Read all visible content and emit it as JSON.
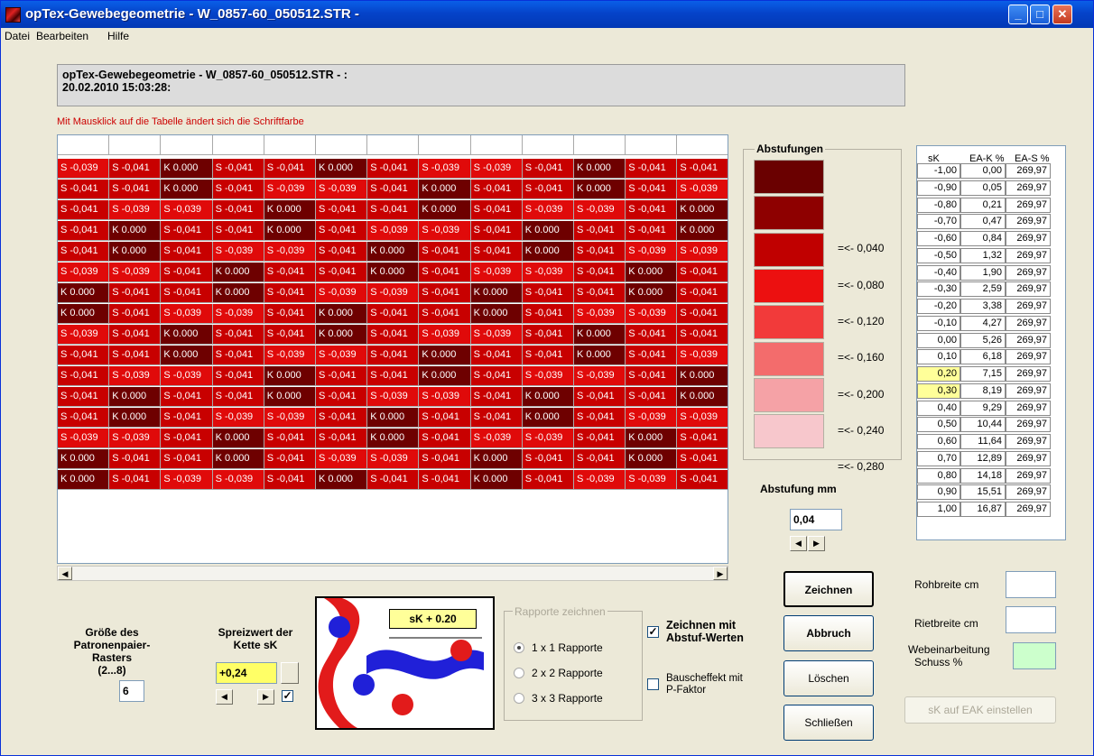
{
  "window": {
    "title": "opTex-Gewebegeometrie - W_0857-60_050512.STR -",
    "controls": [
      "_",
      "□",
      "✕"
    ]
  },
  "menu": [
    "Datei",
    "Bearbeiten",
    "Hilfe"
  ],
  "info": {
    "line1": "opTex-Gewebegeometrie - W_0857-60_050512.STR - :",
    "line2": "20.02.2010 15:03:28:"
  },
  "hint": "Mit Mausklick auf die Tabelle ändert sich die Schriftfarbe",
  "grid_rows": [
    [
      "S -0,039",
      "S -0,041",
      "K 0.000",
      "S -0,041",
      "S -0,041",
      "K 0.000",
      "S -0,041",
      "S -0,039",
      "S -0,039",
      "S -0,041",
      "K 0.000",
      "S -0,041",
      "S -0,041"
    ],
    [
      "S -0,041",
      "S -0,041",
      "K 0.000",
      "S -0,041",
      "S -0,039",
      "S -0,039",
      "S -0,041",
      "K 0.000",
      "S -0,041",
      "S -0,041",
      "K 0.000",
      "S -0,041",
      "S -0,039"
    ],
    [
      "S -0,041",
      "S -0,039",
      "S -0,039",
      "S -0,041",
      "K 0.000",
      "S -0,041",
      "S -0,041",
      "K 0.000",
      "S -0,041",
      "S -0,039",
      "S -0,039",
      "S -0,041",
      "K 0.000"
    ],
    [
      "S -0,041",
      "K 0.000",
      "S -0,041",
      "S -0,041",
      "K 0.000",
      "S -0,041",
      "S -0,039",
      "S -0,039",
      "S -0,041",
      "K 0.000",
      "S -0,041",
      "S -0,041",
      "K 0.000"
    ],
    [
      "S -0,041",
      "K 0.000",
      "S -0,041",
      "S -0,039",
      "S -0,039",
      "S -0,041",
      "K 0.000",
      "S -0,041",
      "S -0,041",
      "K 0.000",
      "S -0,041",
      "S -0,039",
      "S -0,039"
    ],
    [
      "S -0,039",
      "S -0,039",
      "S -0,041",
      "K 0.000",
      "S -0,041",
      "S -0,041",
      "K 0.000",
      "S -0,041",
      "S -0,039",
      "S -0,039",
      "S -0,041",
      "K 0.000",
      "S -0,041"
    ],
    [
      "K 0.000",
      "S -0,041",
      "S -0,041",
      "K 0.000",
      "S -0,041",
      "S -0,039",
      "S -0,039",
      "S -0,041",
      "K 0.000",
      "S -0,041",
      "S -0,041",
      "K 0.000",
      "S -0,041"
    ],
    [
      "K 0.000",
      "S -0,041",
      "S -0,039",
      "S -0,039",
      "S -0,041",
      "K 0.000",
      "S -0,041",
      "S -0,041",
      "K 0.000",
      "S -0,041",
      "S -0,039",
      "S -0,039",
      "S -0,041"
    ],
    [
      "S -0,039",
      "S -0,041",
      "K 0.000",
      "S -0,041",
      "S -0,041",
      "K 0.000",
      "S -0,041",
      "S -0,039",
      "S -0,039",
      "S -0,041",
      "K 0.000",
      "S -0,041",
      "S -0,041"
    ],
    [
      "S -0,041",
      "S -0,041",
      "K 0.000",
      "S -0,041",
      "S -0,039",
      "S -0,039",
      "S -0,041",
      "K 0.000",
      "S -0,041",
      "S -0,041",
      "K 0.000",
      "S -0,041",
      "S -0,039"
    ],
    [
      "S -0,041",
      "S -0,039",
      "S -0,039",
      "S -0,041",
      "K 0.000",
      "S -0,041",
      "S -0,041",
      "K 0.000",
      "S -0,041",
      "S -0,039",
      "S -0,039",
      "S -0,041",
      "K 0.000"
    ],
    [
      "S -0,041",
      "K 0.000",
      "S -0,041",
      "S -0,041",
      "K 0.000",
      "S -0,041",
      "S -0,039",
      "S -0,039",
      "S -0,041",
      "K 0.000",
      "S -0,041",
      "S -0,041",
      "K 0.000"
    ],
    [
      "S -0,041",
      "K 0.000",
      "S -0,041",
      "S -0,039",
      "S -0,039",
      "S -0,041",
      "K 0.000",
      "S -0,041",
      "S -0,041",
      "K 0.000",
      "S -0,041",
      "S -0,039",
      "S -0,039"
    ],
    [
      "S -0,039",
      "S -0,039",
      "S -0,041",
      "K 0.000",
      "S -0,041",
      "S -0,041",
      "K 0.000",
      "S -0,041",
      "S -0,039",
      "S -0,039",
      "S -0,041",
      "K 0.000",
      "S -0,041"
    ],
    [
      "K 0.000",
      "S -0,041",
      "S -0,041",
      "K 0.000",
      "S -0,041",
      "S -0,039",
      "S -0,039",
      "S -0,041",
      "K 0.000",
      "S -0,041",
      "S -0,041",
      "K 0.000",
      "S -0,041"
    ],
    [
      "K 0.000",
      "S -0,041",
      "S -0,039",
      "S -0,039",
      "S -0,041",
      "K 0.000",
      "S -0,041",
      "S -0,041",
      "K 0.000",
      "S -0,041",
      "S -0,039",
      "S -0,039",
      "S -0,041"
    ]
  ],
  "colors": {
    "K": "#6e0000",
    "S041": "#c80000",
    "S039": "#e00a0a",
    "highlight": "#ffff99",
    "green": "#ccffcc"
  },
  "abstufungen": {
    "title": "Abstufungen",
    "swatches": [
      "#6a0000",
      "#8e0000",
      "#c00000",
      "#ec1010",
      "#f23a3a",
      "#f36c6c",
      "#f5a2a6",
      "#f7c7cc"
    ],
    "labels": [
      "",
      "=<- 0,040",
      "=<- 0,080",
      "=<- 0,120",
      "=<- 0,160",
      "=<- 0,200",
      "=<- 0,240",
      "=<- 0,280"
    ]
  },
  "eak": {
    "headers": [
      "sK",
      "EA-K %",
      "EA-S %"
    ],
    "rows": [
      [
        "-1,00",
        "0,00",
        "269,97"
      ],
      [
        "-0,90",
        "0,05",
        "269,97"
      ],
      [
        "-0,80",
        "0,21",
        "269,97"
      ],
      [
        "-0,70",
        "0,47",
        "269,97"
      ],
      [
        "-0,60",
        "0,84",
        "269,97"
      ],
      [
        "-0,50",
        "1,32",
        "269,97"
      ],
      [
        "-0,40",
        "1,90",
        "269,97"
      ],
      [
        "-0,30",
        "2,59",
        "269,97"
      ],
      [
        "-0,20",
        "3,38",
        "269,97"
      ],
      [
        "-0,10",
        "4,27",
        "269,97"
      ],
      [
        "0,00",
        "5,26",
        "269,97"
      ],
      [
        "0,10",
        "6,18",
        "269,97"
      ],
      [
        "0,20",
        "7,15",
        "269,97"
      ],
      [
        "0,30",
        "8,19",
        "269,97"
      ],
      [
        "0,40",
        "9,29",
        "269,97"
      ],
      [
        "0,50",
        "10,44",
        "269,97"
      ],
      [
        "0,60",
        "11,64",
        "269,97"
      ],
      [
        "0,70",
        "12,89",
        "269,97"
      ],
      [
        "0,80",
        "14,18",
        "269,97"
      ],
      [
        "0,90",
        "15,51",
        "269,97"
      ],
      [
        "1,00",
        "16,87",
        "269,97"
      ]
    ],
    "highlighted": [
      "0,20",
      "0,30"
    ]
  },
  "abstufung_mm": {
    "label": "Abstufung mm",
    "value": "0,04"
  },
  "buttons": {
    "zeichnen": "Zeichnen",
    "abbruch": "Abbruch",
    "loeschen": "Löschen",
    "schliessen": "Schließen",
    "eak": "sK auf EAK einstellen"
  },
  "right_fields": {
    "rohbreite": "Rohbreite cm",
    "rietbreite": "Rietbreite cm",
    "webe1": "Webeinarbeitung",
    "webe2": "Schuss %"
  },
  "groesse": {
    "l1": "Größe des",
    "l2": "Patronenpaier-Rasters",
    "l3": "(2...8)",
    "value": "6"
  },
  "spreiz": {
    "l1": "Spreizwert der",
    "l2": "Kette sK",
    "value": "+0,24"
  },
  "preview_label": "sK + 0.20",
  "rapporte": {
    "title": "Rapporte zeichnen",
    "options": [
      "1 x 1 Rapporte",
      "2 x 2 Rapporte",
      "3 x 3 Rapporte"
    ]
  },
  "checks": {
    "zeichnen1": "Zeichnen mit",
    "zeichnen2": "Abstuf-Werten",
    "bausch1": "Bauscheffekt mit",
    "bausch2": "P-Faktor",
    "check_mark": "✓"
  }
}
